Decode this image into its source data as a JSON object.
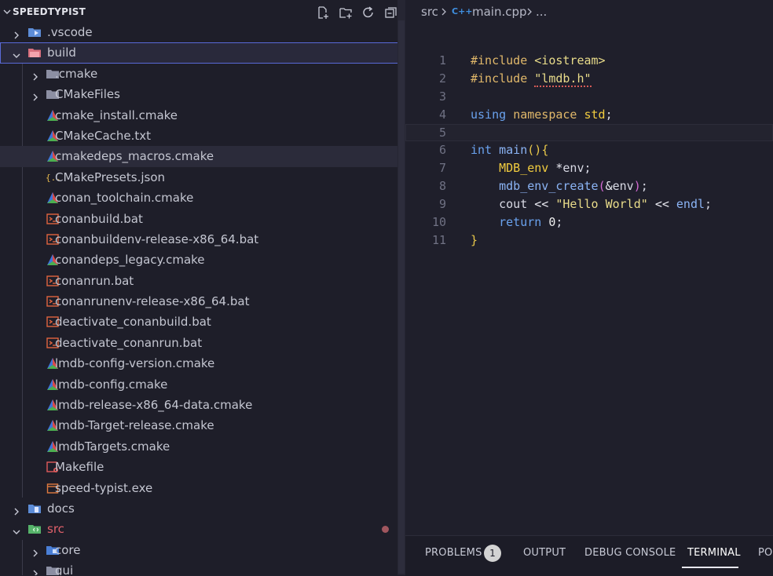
{
  "explorer": {
    "title": "SPEEDTYPIST",
    "tree": [
      {
        "label": ".vscode",
        "icon": "vscode-folder-icon",
        "depth": 0,
        "twistie": "closed"
      },
      {
        "label": "build",
        "icon": "build-folder-icon",
        "depth": 0,
        "twistie": "open",
        "state": "selected"
      },
      {
        "label": ".cmake",
        "icon": "folder-icon",
        "depth": 1,
        "twistie": "closed"
      },
      {
        "label": "CMakeFiles",
        "icon": "folder-icon",
        "depth": 1,
        "twistie": "closed"
      },
      {
        "label": "cmake_install.cmake",
        "icon": "cmake-icon",
        "depth": 1
      },
      {
        "label": "CMakeCache.txt",
        "icon": "cmake-icon",
        "depth": 1
      },
      {
        "label": "cmakedeps_macros.cmake",
        "icon": "cmake-icon",
        "depth": 1,
        "state": "hover"
      },
      {
        "label": "CMakePresets.json",
        "icon": "json-icon",
        "depth": 1
      },
      {
        "label": "conan_toolchain.cmake",
        "icon": "cmake-icon",
        "depth": 1
      },
      {
        "label": "conanbuild.bat",
        "icon": "terminal-icon",
        "depth": 1
      },
      {
        "label": "conanbuildenv-release-x86_64.bat",
        "icon": "terminal-icon",
        "depth": 1
      },
      {
        "label": "conandeps_legacy.cmake",
        "icon": "cmake-icon",
        "depth": 1
      },
      {
        "label": "conanrun.bat",
        "icon": "terminal-icon",
        "depth": 1
      },
      {
        "label": "conanrunenv-release-x86_64.bat",
        "icon": "terminal-icon",
        "depth": 1
      },
      {
        "label": "deactivate_conanbuild.bat",
        "icon": "terminal-icon",
        "depth": 1
      },
      {
        "label": "deactivate_conanrun.bat",
        "icon": "terminal-icon",
        "depth": 1
      },
      {
        "label": "lmdb-config-version.cmake",
        "icon": "cmake-icon",
        "depth": 1
      },
      {
        "label": "lmdb-config.cmake",
        "icon": "cmake-icon",
        "depth": 1
      },
      {
        "label": "lmdb-release-x86_64-data.cmake",
        "icon": "cmake-icon",
        "depth": 1
      },
      {
        "label": "lmdb-Target-release.cmake",
        "icon": "cmake-icon",
        "depth": 1
      },
      {
        "label": "lmdbTargets.cmake",
        "icon": "cmake-icon",
        "depth": 1
      },
      {
        "label": "Makefile",
        "icon": "makefile-icon",
        "depth": 1
      },
      {
        "label": "speed-typist.exe",
        "icon": "exe-icon",
        "depth": 1
      },
      {
        "label": "docs",
        "icon": "docs-folder-icon",
        "depth": 0,
        "twistie": "closed"
      },
      {
        "label": "src",
        "icon": "src-folder-icon",
        "depth": 0,
        "twistie": "open",
        "label_color": "#e0606a"
      },
      {
        "label": "core",
        "icon": "core-folder-icon",
        "depth": 1,
        "twistie": "closed"
      },
      {
        "label": "gui",
        "icon": "folder-icon",
        "depth": 1,
        "twistie": "closed"
      }
    ]
  },
  "breadcrumb": {
    "src": "src",
    "file": "main.cpp",
    "file_icon_text": "C++",
    "more": "..."
  },
  "code": {
    "lines": [
      {
        "n": "1",
        "tokens": [
          [
            "pp",
            "#include "
          ],
          [
            "str",
            "<iostream>"
          ]
        ]
      },
      {
        "n": "2",
        "tokens": [
          [
            "pp",
            "#include "
          ],
          [
            "str",
            "\"lmdb.h\"",
            "squiggle"
          ]
        ]
      },
      {
        "n": "3",
        "tokens": []
      },
      {
        "n": "4",
        "tokens": [
          [
            "kw",
            "using "
          ],
          [
            "pp",
            "namespace "
          ],
          [
            "ty",
            "std"
          ],
          [
            "pl",
            ";"
          ]
        ]
      },
      {
        "n": "5",
        "tokens": [],
        "current": true
      },
      {
        "n": "6",
        "tokens": [
          [
            "kw",
            "int "
          ],
          [
            "fn",
            "main"
          ],
          [
            "br1",
            "()"
          ],
          [
            "br1",
            "{"
          ]
        ]
      },
      {
        "n": "7",
        "tokens": [
          [
            "pl",
            "    "
          ],
          [
            "ty",
            "MDB_env "
          ],
          [
            "op",
            "*"
          ],
          [
            "pl",
            "env;"
          ]
        ]
      },
      {
        "n": "8",
        "tokens": [
          [
            "pl",
            "    "
          ],
          [
            "fn",
            "mdb_env_create"
          ],
          [
            "br2",
            "("
          ],
          [
            "op",
            "&"
          ],
          [
            "pl",
            "env"
          ],
          [
            "br2",
            ")"
          ],
          [
            "pl",
            ";"
          ]
        ]
      },
      {
        "n": "9",
        "tokens": [
          [
            "pl",
            "    cout "
          ],
          [
            "op",
            "<< "
          ],
          [
            "str",
            "\"Hello World\" "
          ],
          [
            "op",
            "<< "
          ],
          [
            "fn",
            "endl"
          ],
          [
            "pl",
            ";"
          ]
        ]
      },
      {
        "n": "10",
        "tokens": [
          [
            "pl",
            "    "
          ],
          [
            "kw",
            "return "
          ],
          [
            "num",
            "0"
          ],
          [
            "pl",
            ";"
          ]
        ]
      },
      {
        "n": "11",
        "tokens": [
          [
            "br1",
            "}"
          ]
        ]
      }
    ]
  },
  "panel": {
    "tabs": [
      "PROBLEMS",
      "OUTPUT",
      "DEBUG CONSOLE",
      "TERMINAL",
      "PO"
    ],
    "problems_count": "1",
    "active_tab": "TERMINAL"
  },
  "colors": {
    "accent": "#5a6ad8",
    "modified_dot": "#a0565e"
  }
}
